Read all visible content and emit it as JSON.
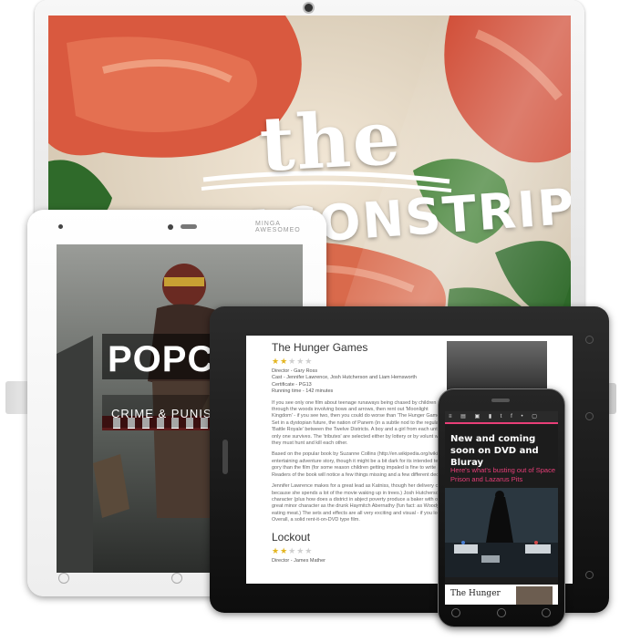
{
  "monitor": {
    "logo_the": "the",
    "logo_strip": "BACONSTRIP"
  },
  "tablet_white": {
    "brand": "MINGA AWESOMEO",
    "poster_title": "POPCOR",
    "poster_subtitle": "CRIME & PUNISHMENT"
  },
  "tablet_black": {
    "movie1": {
      "title": "The Hunger Games",
      "rating": 2,
      "director": "Director - Gary Ross",
      "cast": "Cast - Jennifer Lawrence, Josh Hutcherson and Liam Hemsworth",
      "certificate": "Certificate - PG13",
      "running_time": "Running time - 142 minutes",
      "para1": "If you see only one film about teenage runaways being chased by children through the woods involving bows and arrows, then rent out 'Moonlight Kingdom' - if you see two, then you could do worse than 'The Hunger Games'. Set in a dystopian future, the nation of Panem (in a subtle nod to the regular 'Battle Royale' between the Twelve Districts. A boy and a girl from each until only one survives. The 'tributes' are selected either by lottery or by volunt where they must hunt and kill each other.",
      "para2": "Based on the popular book by Suzanne Collins (http://en.wikipedia.org/wiki/Th entertaining adventure story, though it might be a bit dark for its intended teens gory than the film (for some reason children getting impaled is fine to write abo Readers of the book will notice a few things missing and a few different decisio",
      "para3": "Jennifer Lawrence makes for a great lead as Katniss, though her delivery can because she spends a lot of the movie waking up in trees.) Josh Hutcherson's character (plus how does a district in abject poverty produce a baker with out a great minor character as the drunk Haymitch Abernathy (fun fact: as Woody eating meat.) The sets and effects are all very exciting and visual - if you love Overall, a solid rent-it-on-DVD type film."
    },
    "movie2": {
      "title": "Lockout",
      "rating": 2,
      "director": "Director - James Mather"
    }
  },
  "phone": {
    "toolbar": "≡ ▤ ▣ ▮ t f • ▢",
    "headline": "New and coming soon on DVD and Bluray",
    "subhead": "Here's what's busting out of Space Prison and Lazarus Pits",
    "card_title": "The Hunger"
  },
  "colors": {
    "phone_accent": "#e83e78",
    "star_on": "#e3b51f",
    "star_off": "#cfcfcf"
  }
}
